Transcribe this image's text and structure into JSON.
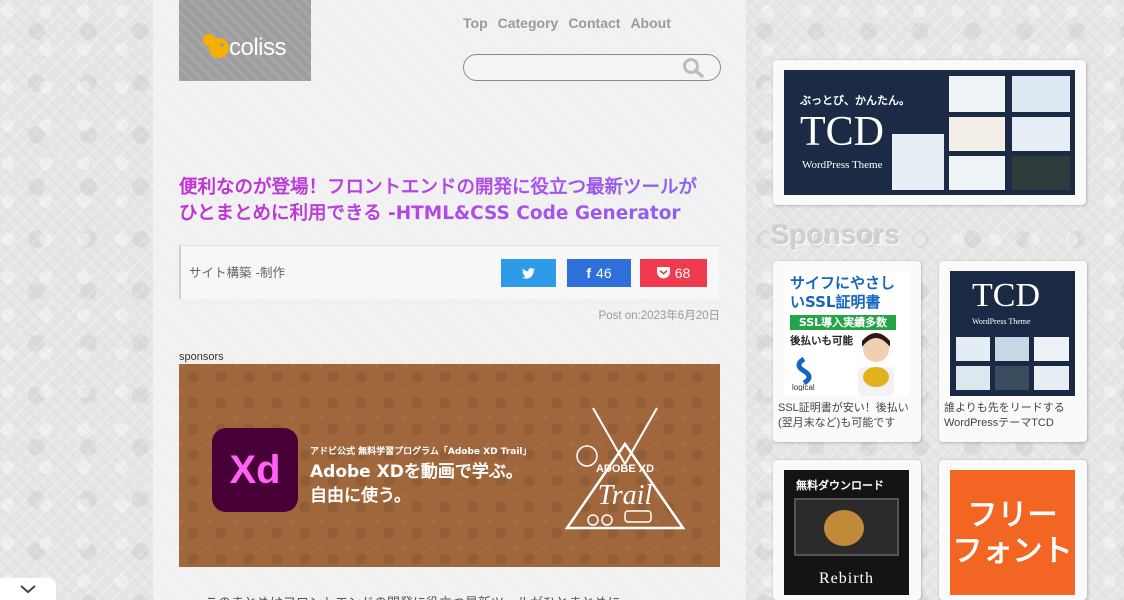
{
  "brand": {
    "logo_text": "coliss"
  },
  "nav": {
    "items": [
      "Top",
      "Category",
      "Contact",
      "About"
    ]
  },
  "search": {
    "placeholder": ""
  },
  "article": {
    "title_line1": "便利なのが登場！フロントエンドの開発に役立つ最新ツールが",
    "title_line2": "ひとまとめに利用できる -HTML&CSS Code Generator",
    "category": "サイト構築 -制作",
    "share": {
      "facebook_count": "46",
      "pocket_count": "68"
    },
    "post_date": "Post on:2023年6月20日",
    "sponsors_label": "sponsors",
    "body_preview": "　　このまとめはフロントエンドの開発に役立つ最新ツールがひとまとめに"
  },
  "ad_banner": {
    "logo": "Xd",
    "small": "アドビ公式 無料学習プログラム「Adobe XD Trail」",
    "line1": "Adobe XDを動画で学ぶ。",
    "line2": "自由に使う。",
    "trail_top": "ADOBE XD",
    "trail_word": "Trail"
  },
  "sidebar": {
    "tcd_banner": {
      "pre": "ぶっとび、かんたん。",
      "big": "TCD",
      "sub": "WordPress Theme"
    },
    "sponsors_heading": "Sponsors",
    "ads": [
      {
        "title": "サイフにやさしいSSL証明書",
        "badge": "SSL導入実績多数",
        "sub": "後払いも可能",
        "logo": "logical",
        "caption": "SSL証明書が安い！後払い(翌月末など)も可能です"
      },
      {
        "big": "TCD",
        "sub": "WordPress Theme",
        "caption": "誰よりも先をリードするWordPressテーマTCD"
      },
      {
        "top": "無料ダウンロード",
        "name": "Rebirth"
      },
      {
        "text_line1": "フリー",
        "text_line2": "フォント"
      }
    ]
  },
  "colors": {
    "title_gradient_start": "#c42fd0",
    "title_gradient_end": "#8568f0",
    "twitter": "#2d9be8",
    "facebook": "#2f6fd9",
    "pocket": "#ef3b4d",
    "xd_bg": "#470137",
    "xd_text": "#ff61f6"
  }
}
